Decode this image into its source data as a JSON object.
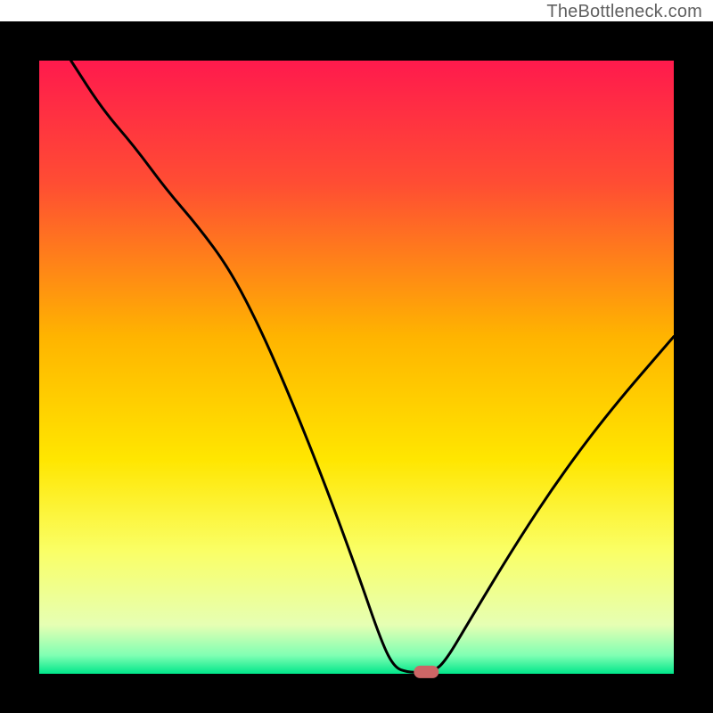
{
  "watermark": "TheBottleneck.com",
  "chart_data": {
    "type": "line",
    "title": "",
    "xlabel": "",
    "ylabel": "",
    "xlim": [
      0,
      100
    ],
    "ylim": [
      0,
      100
    ],
    "background_gradient_stops": [
      {
        "offset": 0.0,
        "color": "#ff1a4d"
      },
      {
        "offset": 0.2,
        "color": "#ff4d33"
      },
      {
        "offset": 0.45,
        "color": "#ffb400"
      },
      {
        "offset": 0.65,
        "color": "#ffe600"
      },
      {
        "offset": 0.8,
        "color": "#faff66"
      },
      {
        "offset": 0.92,
        "color": "#e6ffb3"
      },
      {
        "offset": 0.97,
        "color": "#80ffb3"
      },
      {
        "offset": 1.0,
        "color": "#00e68a"
      }
    ],
    "curve_points": [
      {
        "x": 5,
        "y": 100
      },
      {
        "x": 10,
        "y": 92
      },
      {
        "x": 15,
        "y": 86
      },
      {
        "x": 20,
        "y": 79
      },
      {
        "x": 25,
        "y": 73
      },
      {
        "x": 30,
        "y": 66
      },
      {
        "x": 35,
        "y": 56
      },
      {
        "x": 40,
        "y": 44
      },
      {
        "x": 45,
        "y": 31
      },
      {
        "x": 50,
        "y": 17
      },
      {
        "x": 54,
        "y": 5
      },
      {
        "x": 56,
        "y": 1
      },
      {
        "x": 58,
        "y": 0.3
      },
      {
        "x": 60,
        "y": 0.2
      },
      {
        "x": 62,
        "y": 0.3
      },
      {
        "x": 64,
        "y": 2
      },
      {
        "x": 68,
        "y": 9
      },
      {
        "x": 75,
        "y": 21
      },
      {
        "x": 82,
        "y": 32
      },
      {
        "x": 90,
        "y": 43
      },
      {
        "x": 100,
        "y": 55
      }
    ],
    "marker": {
      "x": 61,
      "y": 0.3,
      "color": "#cc6666"
    },
    "plot_border_color": "#000000",
    "plot_border_width_fraction": 0.055
  }
}
